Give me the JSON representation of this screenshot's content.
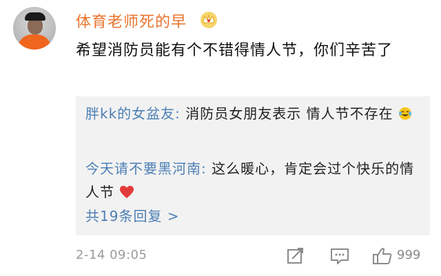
{
  "comment": {
    "username": "体育老师死的早",
    "text": "希望消防员能有个不错得情人节，你们辛苦了",
    "avatar_icon": "avatar-photo",
    "badge_icon": "crown-icon",
    "time": "2-14 09:05",
    "like_count": "999"
  },
  "replies": [
    {
      "author": "胖kk的女盆友:",
      "text": " 消防员女朋友表示 情人节不存在",
      "emoji": "laughing-tears-emoji"
    },
    {
      "author": "今天请不要黑河南:",
      "text": " 这么暖心，肯定会过个快乐的情人节",
      "emoji": "red-heart-emoji"
    }
  ],
  "more_replies_label": "共19条回复 >",
  "colors": {
    "username": "#e8732c",
    "reply_author": "#4c7fb5",
    "reply_bg": "#f2f2f2",
    "meta": "#9a9a9a"
  },
  "icons": {
    "forward": "forward-icon",
    "comment": "comment-icon",
    "like": "thumbs-up-icon"
  }
}
